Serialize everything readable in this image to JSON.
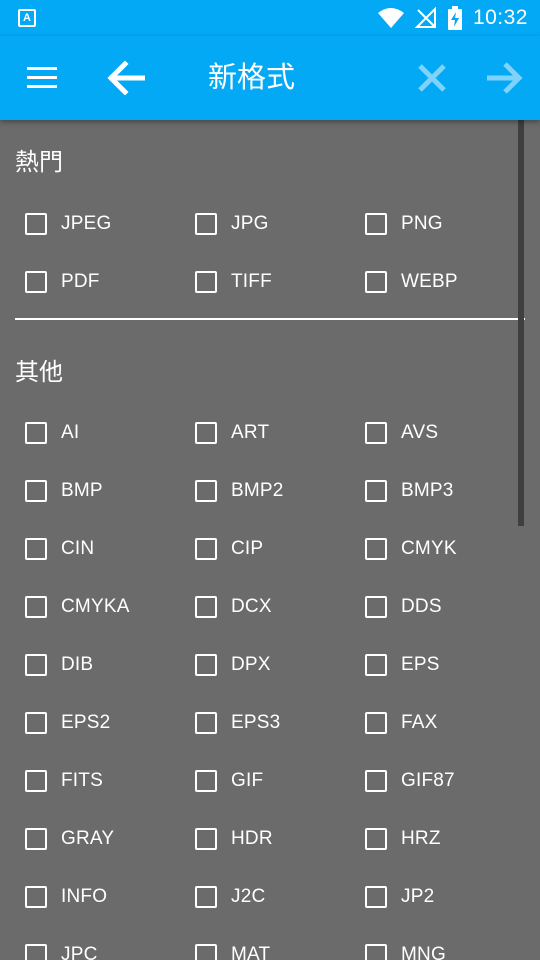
{
  "status_bar": {
    "time": "10:32",
    "app_icon_letter": "A"
  },
  "app_bar": {
    "title": "新格式"
  },
  "sections": [
    {
      "title": "熱門",
      "items": [
        "JPEG",
        "JPG",
        "PNG",
        "PDF",
        "TIFF",
        "WEBP"
      ]
    },
    {
      "title": "其他",
      "items": [
        "AI",
        "ART",
        "AVS",
        "BMP",
        "BMP2",
        "BMP3",
        "CIN",
        "CIP",
        "CMYK",
        "CMYKA",
        "DCX",
        "DDS",
        "DIB",
        "DPX",
        "EPS",
        "EPS2",
        "EPS3",
        "FAX",
        "FITS",
        "GIF",
        "GIF87",
        "GRAY",
        "HDR",
        "HRZ",
        "INFO",
        "J2C",
        "JP2",
        "JPC",
        "MAT",
        "MNG"
      ]
    }
  ],
  "colors": {
    "accent": "#03a9f4",
    "background": "#6b6b6b",
    "disabled_icon": "#7fd3fa"
  }
}
